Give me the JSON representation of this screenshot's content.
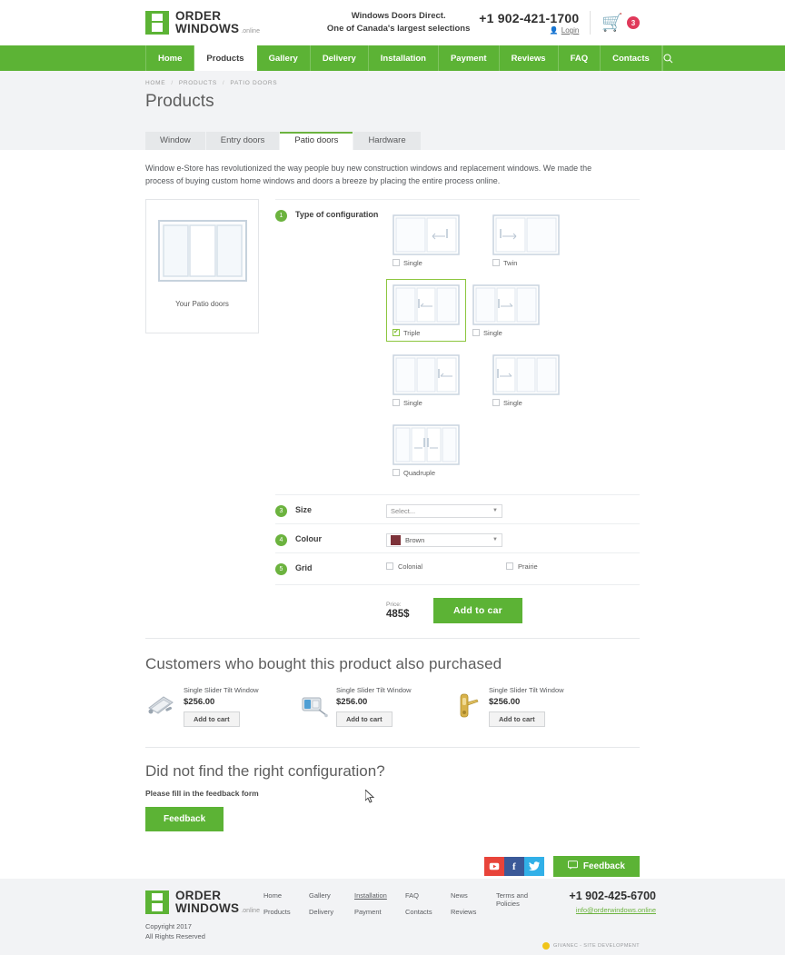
{
  "header": {
    "logo": {
      "line1": "ORDER",
      "line2": "WINDOWS",
      "suffix": ".online"
    },
    "tagline_line1": "Windows Doors Direct.",
    "tagline_line2": "One of Canada's largest selections",
    "phone": "+1 902-421-1700",
    "login_label": "Login",
    "cart_count": "3"
  },
  "nav": {
    "items": [
      {
        "label": "Home",
        "active": false
      },
      {
        "label": "Products",
        "active": true
      },
      {
        "label": "Gallery",
        "active": false
      },
      {
        "label": "Delivery",
        "active": false
      },
      {
        "label": "Installation",
        "active": false
      },
      {
        "label": "Payment",
        "active": false
      },
      {
        "label": "Reviews",
        "active": false
      },
      {
        "label": "FAQ",
        "active": false
      },
      {
        "label": "Contacts",
        "active": false
      }
    ],
    "search_icon": "search-icon"
  },
  "breadcrumb": {
    "home": "HOME",
    "products": "PRODUCTS",
    "current": "PATIO DOORS",
    "separator": "/"
  },
  "page_title": "Products",
  "tabs": [
    {
      "label": "Window",
      "active": false
    },
    {
      "label": "Entry doors",
      "active": false
    },
    {
      "label": "Patio doors",
      "active": true
    },
    {
      "label": "Hardware",
      "active": false
    }
  ],
  "intro": "Window e-Store has revolutionized the way people buy new construction windows and replacement windows. We made the process of buying custom home windows and doors a breeze by placing the entire process online.",
  "preview": {
    "label": "Your Patio doors"
  },
  "configurator": {
    "step1": {
      "number": "1",
      "label": "Type of configuration"
    },
    "options": [
      {
        "label": "Single",
        "selected": false,
        "panels": 2,
        "handle": "right"
      },
      {
        "label": "Twin",
        "selected": false,
        "panels": 2,
        "handle": "left"
      },
      {
        "label": "Triple",
        "selected": true,
        "panels": 3,
        "handle": "mid"
      },
      {
        "label": "Single",
        "selected": false,
        "panels": 3,
        "handle": "mid"
      },
      {
        "label": "Single",
        "selected": false,
        "panels": 3,
        "handle": "right"
      },
      {
        "label": "Single",
        "selected": false,
        "panels": 3,
        "handle": "left"
      },
      {
        "label": "Quadruple",
        "selected": false,
        "panels": 4,
        "handle": "mid"
      }
    ],
    "step3": {
      "number": "3",
      "label": "Size",
      "select_placeholder": "Select..."
    },
    "step4": {
      "number": "4",
      "label": "Colour",
      "value": "Brown",
      "swatch_hex": "#7d3239"
    },
    "step5": {
      "number": "5",
      "label": "Grid",
      "choices": [
        {
          "label": "Colonial",
          "checked": false
        },
        {
          "label": "Prairie",
          "checked": false
        }
      ]
    },
    "price_caption": "Price:",
    "price_value": "485$",
    "add_to_cart_label": "Add to car"
  },
  "also_purchased": {
    "title": "Customers who bought this product also purchased",
    "items": [
      {
        "name": "Single Slider Tilt Window",
        "price": "$256.00",
        "button": "Add to cart",
        "icon": "window-hardware-icon"
      },
      {
        "name": "Single Slider Tilt Window",
        "price": "$256.00",
        "button": "Add to cart",
        "icon": "window-latch-icon"
      },
      {
        "name": "Single Slider Tilt Window",
        "price": "$256.00",
        "button": "Add to cart",
        "icon": "door-handle-icon"
      }
    ]
  },
  "feedback_section": {
    "title": "Did not find the right configuration?",
    "subtitle": "Please fill in the feedback form",
    "button": "Feedback"
  },
  "social": {
    "youtube": "youtube-icon",
    "facebook": "facebook-icon",
    "twitter": "twitter-icon",
    "feedback_button": "Feedback"
  },
  "footer": {
    "logo": {
      "line1": "ORDER",
      "line2": "WINDOWS",
      "suffix": ".online"
    },
    "columns": [
      {
        "top": "Home",
        "bottom": "Products"
      },
      {
        "top": "Gallery",
        "bottom": "Delivery"
      },
      {
        "top": "Installation",
        "bottom": "Payment"
      },
      {
        "top": "FAQ",
        "bottom": "Contacts"
      },
      {
        "top": "News",
        "bottom": "Reviews"
      }
    ],
    "terms": "Terms and Policies",
    "phone": "+1 902-425-6700",
    "email": "info@orderwindows.online",
    "copyright_line1": "Copyright 2017",
    "copyright_line2": "All Rights Reserved",
    "credit": "GIVANEC - SITE DEVELOPMENT"
  },
  "colors": {
    "brand_green": "#5cb335",
    "accent_green": "#6cb33f",
    "cart_red": "#e0395a",
    "colour_swatch": "#7d3239"
  }
}
